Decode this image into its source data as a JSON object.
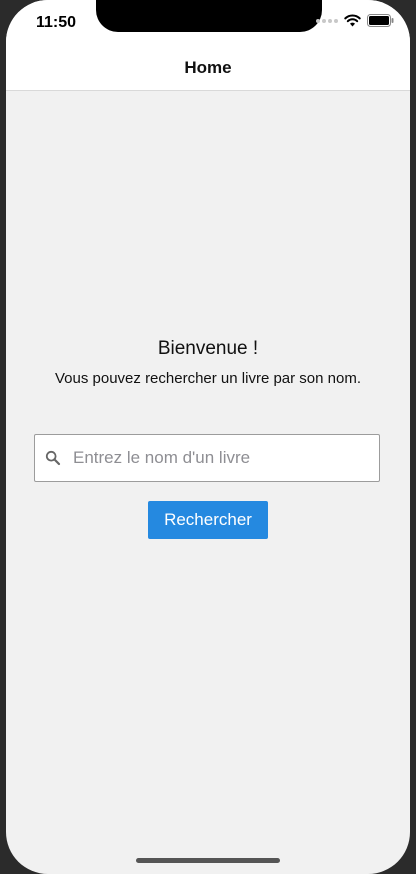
{
  "status_bar": {
    "time": "11:50",
    "icons": [
      "signal-icon",
      "wifi-icon",
      "battery-icon"
    ]
  },
  "nav": {
    "title": "Home"
  },
  "main": {
    "welcome": "Bienvenue !",
    "subtitle": "Vous pouvez rechercher un livre par son nom.",
    "search": {
      "placeholder": "Entrez le nom d'un livre",
      "value": "",
      "icon": "search-icon"
    },
    "search_button_label": "Rechercher"
  },
  "colors": {
    "accent": "#2589e0",
    "background": "#f1f1f1",
    "header": "#ffffff"
  }
}
